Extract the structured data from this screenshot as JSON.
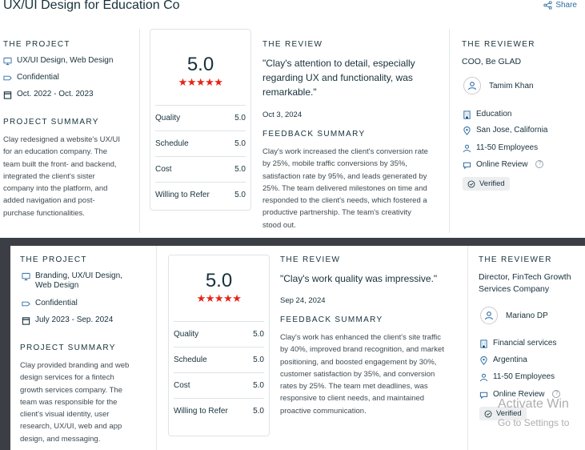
{
  "header": {
    "title": "UX/UI Design for Education Co",
    "share_label": "Share"
  },
  "reviews": [
    {
      "project_heading": "THE PROJECT",
      "services": "UX/UI Design, Web Design",
      "confidentiality": "Confidential",
      "period": "Oct. 2022 - Oct. 2023",
      "summary_heading": "PROJECT SUMMARY",
      "summary": [
        "Clay redesigned a website's UX/UI",
        "for an education company. The",
        "team built the front- and backend,",
        "integrated the client's sister",
        "company into the platform, and",
        "added navigation and post-",
        "purchase functionalities."
      ],
      "overall": "5.0",
      "stars": "★★★★★",
      "ratings": [
        {
          "label": "Quality",
          "value": "5.0"
        },
        {
          "label": "Schedule",
          "value": "5.0"
        },
        {
          "label": "Cost",
          "value": "5.0"
        },
        {
          "label": "Willing to Refer",
          "value": "5.0"
        }
      ],
      "review_heading": "THE REVIEW",
      "quote": [
        "\"Clay's attention to detail, especially",
        "regarding UX and functionality, was",
        "remarkable.\""
      ],
      "date": "Oct 3, 2024",
      "feedback_heading": "FEEDBACK SUMMARY",
      "feedback": [
        "Clay's work increased the client's conversion rate",
        "by 25%, mobile traffic conversions by 35%,",
        "satisfaction rate by 95%, and leads generated by",
        "25%. The team delivered milestones on time and",
        "responded to the client's needs, which fostered a",
        "productive partnership. The team's creativity",
        "stood out."
      ],
      "reviewer_heading": "THE REVIEWER",
      "reviewer_role": [
        "COO, Be GLAD"
      ],
      "reviewer_name": "Tamim Khan",
      "industry": "Education",
      "location": "San Jose, California",
      "employees": "11-50 Employees",
      "review_type": "Online Review",
      "verified": "Verified"
    },
    {
      "project_heading": "THE PROJECT",
      "services": [
        "Branding, UX/UI Design,",
        "Web Design"
      ],
      "confidentiality": "Confidential",
      "period": "July 2023 - Sep. 2024",
      "summary_heading": "PROJECT SUMMARY",
      "summary": [
        "Clay provided branding and web",
        "design services for a fintech",
        "growth services company. The",
        "team was responsible for the",
        "client's visual identity, user",
        "research, UX/UI, web and app",
        "design, and messaging."
      ],
      "overall": "5.0",
      "stars": "★★★★★",
      "ratings": [
        {
          "label": "Quality",
          "value": "5.0"
        },
        {
          "label": "Schedule",
          "value": "5.0"
        },
        {
          "label": "Cost",
          "value": "5.0"
        },
        {
          "label": "Willing to Refer",
          "value": "5.0"
        }
      ],
      "review_heading": "THE REVIEW",
      "quote": [
        "\"Clay's work quality was impressive.\""
      ],
      "date": "Sep 24, 2024",
      "feedback_heading": "FEEDBACK SUMMARY",
      "feedback": [
        "Clay's work has enhanced the client's site traffic",
        "by 40%, improved brand recognition, and market",
        "positioning, and boosted engagement by 30%,",
        "customer satisfaction by 35%, and conversion",
        "rates by 25%. The team met deadlines, was",
        "responsive to client needs, and maintained",
        "proactive communication."
      ],
      "reviewer_heading": "THE REVIEWER",
      "reviewer_role": [
        "Director, FinTech Growth",
        "Services Company"
      ],
      "reviewer_name": "Mariano DP",
      "industry": "Financial services",
      "location": "Argentina",
      "employees": "11-50 Employees",
      "review_type": "Online Review",
      "verified": "Verified"
    }
  ],
  "watermark": {
    "line1": "Activate Win",
    "line2": "Go to Settings to"
  },
  "colors": {
    "star_red": "#e62415",
    "link_blue": "#2d6da3",
    "icon_blue": "#2d6da3"
  },
  "icons": [
    "share-icon",
    "monitor-icon",
    "tag-icon",
    "calendar-icon",
    "user-icon",
    "building-icon",
    "location-pin-icon",
    "people-icon",
    "chat-icon",
    "help-icon",
    "check-circle-icon"
  ]
}
